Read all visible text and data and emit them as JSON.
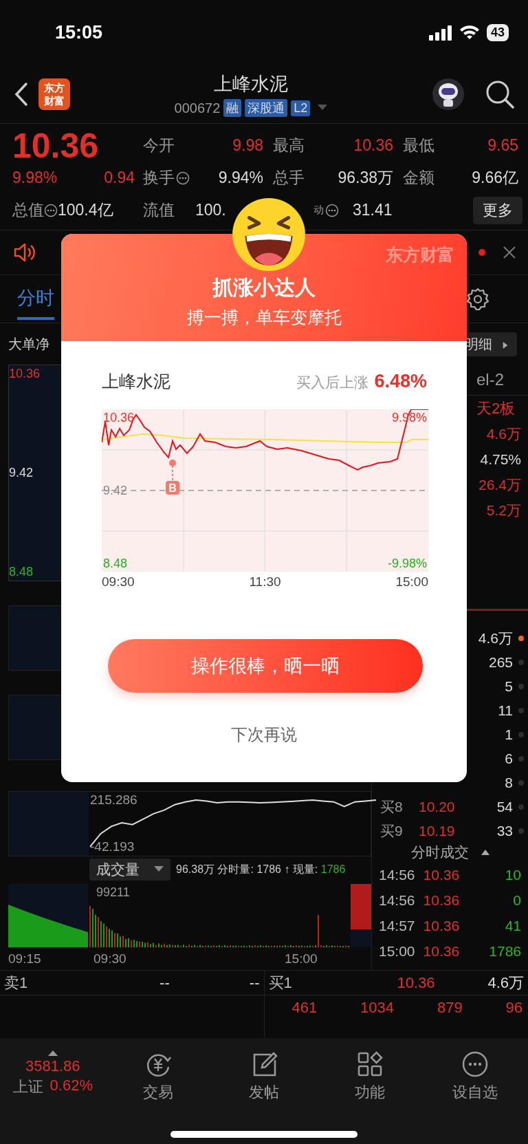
{
  "status_bar": {
    "time": "15:05",
    "battery": "43"
  },
  "header": {
    "logo": "东方财富",
    "title": "上峰水泥",
    "code": "000672",
    "badges": [
      "融",
      "深股通",
      "L2"
    ]
  },
  "quote": {
    "price": "10.36",
    "change_pct": "9.98%",
    "change": "0.94",
    "total_label": "总值",
    "total_value": "100.4亿",
    "stats": [
      {
        "label": "今开",
        "value": "9.98",
        "color": "#e0302a",
        "info": false
      },
      {
        "label": "最高",
        "value": "10.36",
        "color": "#e0302a",
        "info": false
      },
      {
        "label": "最低",
        "value": "9.65",
        "color": "#e0302a",
        "info": false
      },
      {
        "label": "换手",
        "value": "9.94%",
        "color": "#dddddd",
        "info": true
      },
      {
        "label": "总手",
        "value": "96.38万",
        "color": "#dddddd",
        "info": false
      },
      {
        "label": "金额",
        "value": "9.66亿",
        "color": "#dddddd",
        "info": false
      },
      {
        "label": "流值",
        "value": "100.",
        "color": "#dddddd",
        "info": false
      },
      {
        "sup": "动",
        "value": "31.41",
        "color": "#dddddd",
        "info": true
      }
    ],
    "more_button": "更多"
  },
  "tabs": [
    {
      "label": "分时",
      "selected": true
    }
  ],
  "left": {
    "section_label": "大单净",
    "price_labels": [
      {
        "text": "10.36",
        "color": "#e0302a"
      },
      {
        "text": "9.42",
        "color": "#dddddd"
      },
      {
        "text": "8.48",
        "color": "#2cb52a"
      }
    ],
    "retail_chart": {
      "chart_data": {
        "type": "line",
        "ylim": [
          -42.193,
          215.286
        ],
        "yticks": [
          {
            "value": 215.286,
            "label": "215.286"
          },
          {
            "value": -42.193,
            "label": "-42.193"
          }
        ],
        "series": [
          {
            "color": "#dddddd",
            "values": [
              -42,
              30,
              70,
              90,
              80,
              110,
              140,
              160,
              190,
              205,
              215,
              210,
              200,
              205,
              205,
              203,
              200,
              202,
              205,
              208,
              212,
              215,
              210,
              205,
              180,
              205,
              210,
              215
            ]
          }
        ]
      }
    },
    "volume": {
      "selector": "成交量",
      "summary": "96.38万 分时量: 1786 ↑ 现量: ",
      "current": "1786",
      "peak": "99211"
    },
    "times": [
      "09:15",
      "09:30",
      "15:00"
    ]
  },
  "side": {
    "detail_button": "明细",
    "top": [
      {
        "kind": "header",
        "text": "el-2",
        "color": "#999999"
      },
      {
        "kind": "tag",
        "text": "天2板",
        "color": "#e0302a"
      },
      {
        "kind": "value",
        "text": "4.6万",
        "color": "#e0302a"
      },
      {
        "kind": "value",
        "text": "4.75%",
        "color": "#dddddd"
      },
      {
        "kind": "value",
        "text": "26.4万",
        "color": "#e0302a"
      },
      {
        "kind": "value",
        "text": "5.2万",
        "color": "#e0302a"
      }
    ],
    "orders": [
      {
        "volume": "4.6万",
        "color": "#e8651c"
      },
      {
        "volume": "265",
        "color": "#2e2e2e"
      },
      {
        "volume": "5",
        "color": "#2e2e2e"
      },
      {
        "volume": "11",
        "color": "#2e2e2e"
      },
      {
        "volume": "1",
        "color": "#2e2e2e"
      },
      {
        "volume": "6",
        "color": "#2e2e2e"
      },
      {
        "volume": "8",
        "color": "#2e2e2e"
      },
      {
        "name": "买8",
        "price": "10.20",
        "volume": "54",
        "color": "#2e2e2e"
      },
      {
        "name": "买9",
        "price": "10.19",
        "volume": "33",
        "color": "#2e2e2e"
      }
    ],
    "trades_title": "分时成交",
    "trades": [
      {
        "time": "14:56",
        "price": "10.36",
        "volume": "10"
      },
      {
        "time": "14:56",
        "price": "10.36",
        "volume": "0"
      },
      {
        "time": "14:57",
        "price": "10.36",
        "volume": "41"
      },
      {
        "time": "15:00",
        "price": "10.36",
        "volume": "1786"
      }
    ]
  },
  "book": {
    "sell": {
      "name": "卖1",
      "price": "--",
      "volume": "--"
    },
    "buy": {
      "name": "买1",
      "price": "10.36",
      "volume": "4.6万"
    },
    "queue": [
      "461",
      "1034",
      "879",
      "96"
    ]
  },
  "bottom_nav": {
    "index": {
      "value": "3581.86",
      "name": "上证",
      "change": "0.62%"
    },
    "items": [
      {
        "label": "交易"
      },
      {
        "label": "发帖"
      },
      {
        "label": "功能"
      },
      {
        "label": "设自选"
      }
    ]
  },
  "popup": {
    "title": "抓涨小达人",
    "subtitle": "搏一搏，单车变摩托",
    "watermark": "东方财富",
    "stock": "上峰水泥",
    "gain_label": "买入后上涨",
    "gain": "6.48%",
    "chart_labels": {
      "high": "10.36",
      "high_pct": "9.98%",
      "base": "9.42",
      "low": "8.48",
      "low_pct": "-9.98%"
    },
    "buy_marker": "B",
    "times": [
      "09:30",
      "11:30",
      "15:00"
    ],
    "share_button": "操作很棒，晒一晒",
    "dismiss": "下次再说"
  }
}
